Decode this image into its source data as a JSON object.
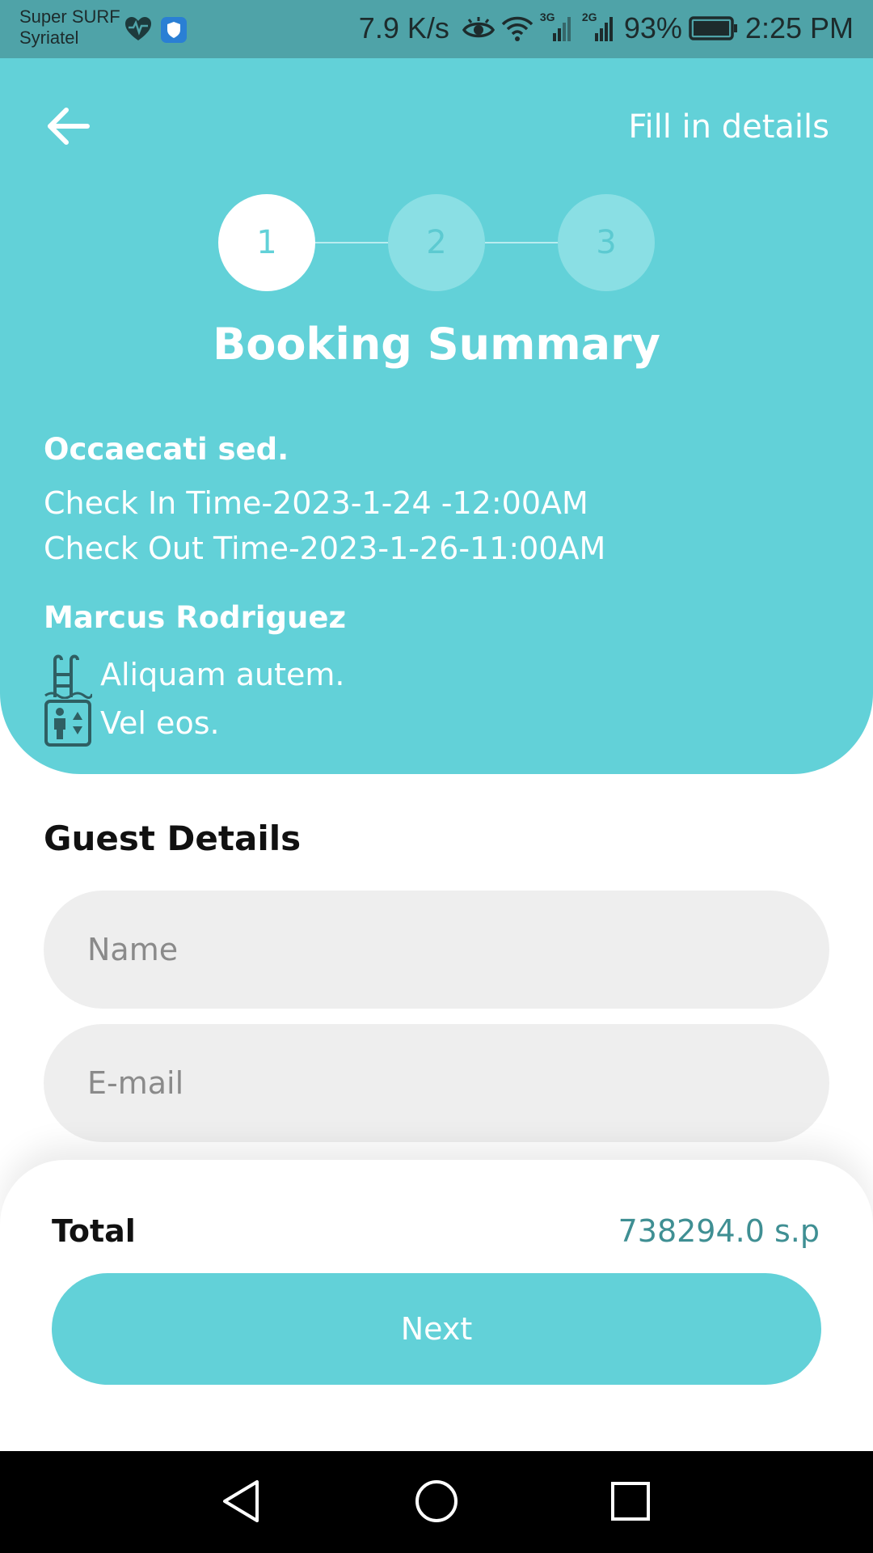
{
  "status_bar": {
    "carrier_line1": "Super SURF",
    "carrier_line2": "Syriatel",
    "speed": "7.9 K/s",
    "net1": "3G",
    "net2": "2G",
    "battery": "93%",
    "time": "2:25 PM"
  },
  "header": {
    "title": "Fill in details"
  },
  "stepper": {
    "steps": [
      "1",
      "2",
      "3"
    ],
    "current_step": 1
  },
  "summary": {
    "title": "Booking Summary",
    "hotel_name": "Occaecati sed.",
    "check_in": "Check In Time-2023-1-24 -12:00AM",
    "check_out": "Check Out Time-2023-1-26-11:00AM",
    "guest_name": "Marcus Rodriguez",
    "amenities": [
      {
        "icon": "pool-icon",
        "label": "Aliquam autem."
      },
      {
        "icon": "elevator-icon",
        "label": "Vel eos."
      }
    ]
  },
  "guest_details": {
    "title": "Guest Details",
    "name_placeholder": "Name",
    "email_placeholder": "E-mail"
  },
  "footer": {
    "total_label": "Total",
    "total_value": "738294.0 s.p",
    "next_label": "Next"
  },
  "colors": {
    "accent": "#62d1d8",
    "status_bar": "#4fa3a8",
    "total_value": "#3f8f93"
  }
}
